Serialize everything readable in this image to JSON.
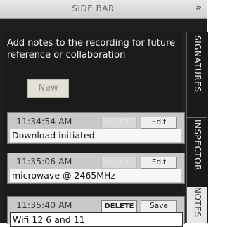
{
  "sidebar": {
    "title": "SIDE BAR",
    "collapse_icon": "double-chevron-right-icon",
    "collapse_glyph": "»",
    "hint": "Add notes to the recording for future reference or collaboration",
    "new_label": "New"
  },
  "notes": [
    {
      "time": "11:34:54 AM",
      "delete_label": "DELETE",
      "action_label": "Edit",
      "text": "Download initiated"
    },
    {
      "time": "11:35:06 AM",
      "delete_label": "DELETE",
      "action_label": "Edit",
      "text": "microwave @ 2465MHz"
    },
    {
      "time": "11:35:40 AM",
      "delete_label": "DELETE",
      "action_label": "Save",
      "text": "Wifi 12 6 and 11"
    }
  ],
  "tabs": [
    {
      "label": "SIGNATURES",
      "active": false
    },
    {
      "label": "INSPECTOR",
      "active": false
    },
    {
      "label": "NOTES",
      "active": true
    }
  ],
  "colors": {
    "background": "#1f1f1f",
    "note_card": "#c9c9c9",
    "active_tab": "#e7e7e7"
  }
}
